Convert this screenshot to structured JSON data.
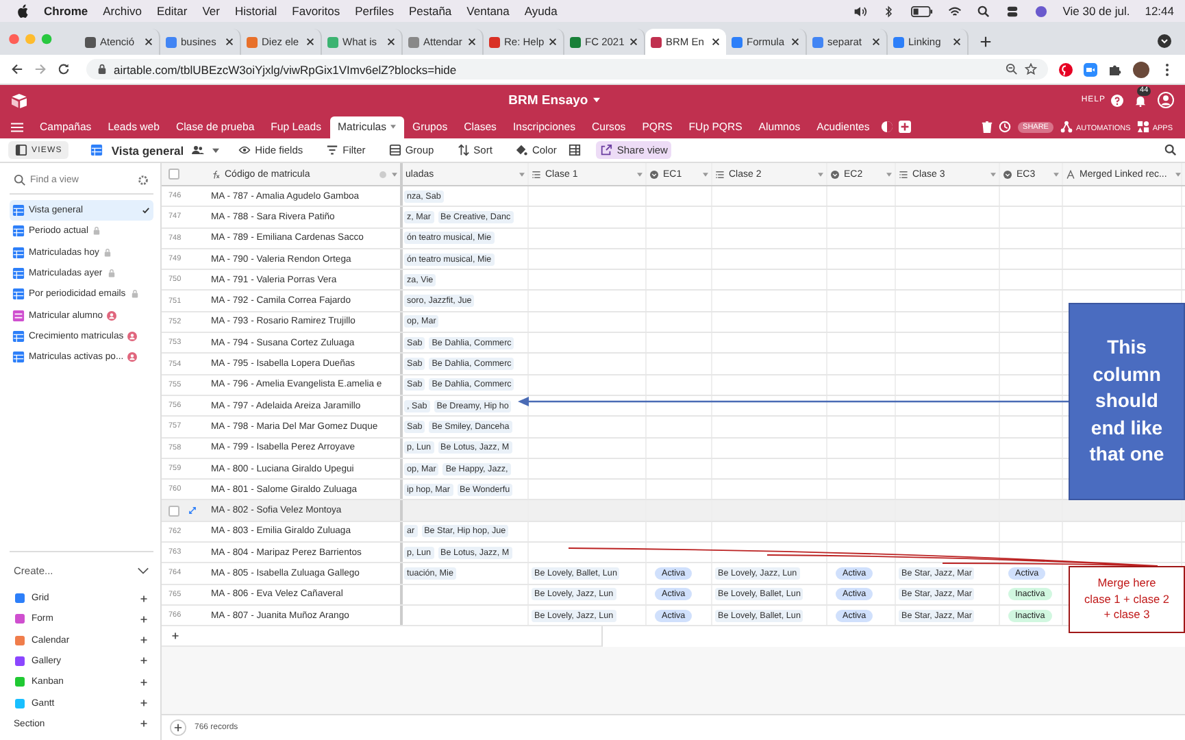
{
  "menubar": {
    "app": "Chrome",
    "items": [
      "Archivo",
      "Editar",
      "Ver",
      "Historial",
      "Favoritos",
      "Perfiles",
      "Pestaña",
      "Ventana",
      "Ayuda"
    ],
    "date": "Vie 30 de jul.",
    "time": "12:44"
  },
  "browser": {
    "tabs": [
      {
        "title": "Atenció",
        "selected": false,
        "color": "#555555"
      },
      {
        "title": "busines",
        "selected": false,
        "color": "#4285f4"
      },
      {
        "title": "Diez ele",
        "selected": false,
        "color": "#e8702a"
      },
      {
        "title": "What is",
        "selected": false,
        "color": "#3cb371"
      },
      {
        "title": "Attendar",
        "selected": false,
        "color": "#888888"
      },
      {
        "title": "Re: Help",
        "selected": false,
        "color": "#d93025"
      },
      {
        "title": "FC 2021",
        "selected": false,
        "color": "#188038"
      },
      {
        "title": "BRM En",
        "selected": true,
        "color": "#c0304f"
      },
      {
        "title": "Formula",
        "selected": false,
        "color": "#2d7ff9"
      },
      {
        "title": "separat",
        "selected": false,
        "color": "#4285f4"
      },
      {
        "title": "Linking",
        "selected": false,
        "color": "#2d7ff9"
      }
    ],
    "url": "airtable.com/tblUBEzcW3oiYjxlg/viwRpGix1VImv6elZ?blocks=hide"
  },
  "app": {
    "title": "BRM Ensayo",
    "help": "HELP",
    "notifications": "44",
    "share": "SHARE",
    "automations": "AUTOMATIONS",
    "apps": "APPS",
    "tables": [
      {
        "label": "Campañas",
        "selected": false
      },
      {
        "label": "Leads web",
        "selected": false
      },
      {
        "label": "Clase de prueba",
        "selected": false
      },
      {
        "label": "Fup Leads",
        "selected": false
      },
      {
        "label": "Matriculas",
        "selected": true
      },
      {
        "label": "Grupos",
        "selected": false
      },
      {
        "label": "Clases",
        "selected": false
      },
      {
        "label": "Inscripciones",
        "selected": false
      },
      {
        "label": "Cursos",
        "selected": false
      },
      {
        "label": "PQRS",
        "selected": false
      },
      {
        "label": "FUp PQRS",
        "selected": false
      },
      {
        "label": "Alumnos",
        "selected": false
      },
      {
        "label": "Acudientes",
        "selected": false
      }
    ]
  },
  "toolbar": {
    "views": "VIEWS",
    "view_name": "Vista general",
    "hide_fields": "Hide fields",
    "filter": "Filter",
    "group": "Group",
    "sort": "Sort",
    "color_button": "Color",
    "share_view": "Share view"
  },
  "sidebar": {
    "search": {
      "placeholder": "Find a view"
    },
    "views": [
      {
        "name": "Vista general",
        "kind": "grid",
        "selected": true,
        "locked": false,
        "personal": false
      },
      {
        "name": "Periodo actual",
        "kind": "grid",
        "selected": false,
        "locked": true,
        "personal": false
      },
      {
        "name": "Matriculadas hoy",
        "kind": "grid",
        "selected": false,
        "locked": true,
        "personal": false
      },
      {
        "name": "Matriculadas ayer",
        "kind": "grid",
        "selected": false,
        "locked": true,
        "personal": false
      },
      {
        "name": "Por periodicidad emails",
        "kind": "grid",
        "selected": false,
        "locked": true,
        "personal": false
      },
      {
        "name": "Matricular alumno",
        "kind": "form",
        "selected": false,
        "locked": false,
        "personal": true
      },
      {
        "name": "Crecimiento matriculas",
        "kind": "grid",
        "selected": false,
        "locked": false,
        "personal": true
      },
      {
        "name": "Matriculas activas po...",
        "kind": "grid",
        "selected": false,
        "locked": false,
        "personal": true
      }
    ],
    "create": "Create...",
    "types": [
      {
        "name": "Grid",
        "color": "#2d7ff9"
      },
      {
        "name": "Form",
        "color": "#cf4fcf"
      },
      {
        "name": "Calendar",
        "color": "#f07d4b"
      },
      {
        "name": "Gallery",
        "color": "#8b46ff"
      },
      {
        "name": "Kanban",
        "color": "#20c933"
      },
      {
        "name": "Gantt",
        "color": "#18bfff"
      }
    ],
    "section": "Section"
  },
  "grid": {
    "all_selected": false,
    "columns": [
      {
        "label": "Código de matricula",
        "kind": "formula"
      },
      {
        "label": "uladas",
        "kind": "partial"
      },
      {
        "label": "Clase 1",
        "kind": "lines"
      },
      {
        "label": "EC1",
        "kind": "select"
      },
      {
        "label": "Clase 2",
        "kind": "lines"
      },
      {
        "label": "EC2",
        "kind": "select"
      },
      {
        "label": "Clase 3",
        "kind": "lines"
      },
      {
        "label": "EC3",
        "kind": "select"
      },
      {
        "label": "Merged Linked rec...",
        "kind": "text"
      }
    ],
    "rows": [
      {
        "number": "746",
        "code": "MA - 787 - Amalia Agudelo Gamboa",
        "hovered": false,
        "column_2": [
          "nza, Sab"
        ]
      },
      {
        "number": "747",
        "code": "MA - 788 - Sara Rivera Patiño",
        "hovered": false,
        "column_2": [
          "z, Mar",
          "Be Creative, Danc"
        ]
      },
      {
        "number": "748",
        "code": "MA - 789 - Emiliana Cardenas Sacco",
        "hovered": false,
        "column_2": [
          "ón teatro musical, Mie"
        ]
      },
      {
        "number": "749",
        "code": "MA - 790 - Valeria Rendon Ortega",
        "hovered": false,
        "column_2": [
          "ón teatro musical, Mie"
        ]
      },
      {
        "number": "750",
        "code": "MA - 791 - Valeria Porras Vera",
        "hovered": false,
        "column_2": [
          "za, Vie"
        ]
      },
      {
        "number": "751",
        "code": "MA - 792 - Camila Correa Fajardo",
        "hovered": false,
        "column_2": [
          "soro, Jazzfit, Jue"
        ]
      },
      {
        "number": "752",
        "code": "MA - 793 - Rosario Ramirez Trujillo",
        "hovered": false,
        "column_2": [
          "op, Mar"
        ]
      },
      {
        "number": "753",
        "code": "MA - 794 - Susana Cortez Zuluaga",
        "hovered": false,
        "column_2": [
          "Sab",
          "Be Dahlia, Commerc"
        ]
      },
      {
        "number": "754",
        "code": "MA - 795 - Isabella Lopera Dueñas",
        "hovered": false,
        "column_2": [
          "Sab",
          "Be Dahlia, Commerc"
        ]
      },
      {
        "number": "755",
        "code": "MA - 796 - Amelia Evangelista E.amelia e",
        "hovered": false,
        "column_2": [
          "Sab",
          "Be Dahlia, Commerc"
        ]
      },
      {
        "number": "756",
        "code": "MA - 797 - Adelaida Areiza Jaramillo",
        "hovered": false,
        "column_2": [
          ", Sab",
          "Be Dreamy, Hip ho"
        ]
      },
      {
        "number": "757",
        "code": "MA - 798 - Maria Del Mar Gomez Duque",
        "hovered": false,
        "column_2": [
          "Sab",
          "Be Smiley, Danceha"
        ]
      },
      {
        "number": "758",
        "code": "MA - 799 - Isabella Perez Arroyave",
        "hovered": false,
        "column_2": [
          "p, Lun",
          "Be Lotus, Jazz, M"
        ]
      },
      {
        "number": "759",
        "code": "MA - 800 - Luciana Giraldo Upegui",
        "hovered": false,
        "column_2": [
          "op, Mar",
          "Be Happy, Jazz,"
        ]
      },
      {
        "number": "760",
        "code": "MA - 801 - Salome Giraldo Zuluaga",
        "hovered": false,
        "column_2": [
          "ip hop, Mar",
          "Be Wonderfu"
        ]
      },
      {
        "code": "MA - 802 - Sofia Velez Montoya",
        "hovered": true,
        "checked": false,
        "column_2": []
      },
      {
        "number": "762",
        "code": "MA - 803 - Emilia Giraldo Zuluaga",
        "hovered": false,
        "column_2": [
          "ar",
          "Be Star, Hip hop, Jue"
        ]
      },
      {
        "number": "763",
        "code": "MA - 804 - Maripaz Perez Barrientos",
        "hovered": false,
        "column_2": [
          "p, Lun",
          "Be Lotus, Jazz, M"
        ]
      },
      {
        "number": "764",
        "code": "MA - 805 - Isabella Zuluaga Gallego",
        "hovered": false,
        "column_2": [
          "tuación, Mie"
        ],
        "clase_1": "Be Lovely, Ballet, Lun",
        "ec1": {
          "label": "Activa",
          "color": "#d0e0fc"
        },
        "clase_2": "Be Lovely, Jazz, Lun",
        "ec2": {
          "label": "Activa",
          "color": "#d0e0fc"
        },
        "clase_3": "Be Star, Jazz, Mar",
        "ec3": {
          "label": "Activa",
          "color": "#d0e0fc"
        }
      },
      {
        "number": "765",
        "code": "MA - 806 - Eva Velez Cañaveral",
        "hovered": false,
        "column_2": [],
        "clase_1": "Be Lovely, Jazz, Lun",
        "ec1": {
          "label": "Activa",
          "color": "#d0e0fc"
        },
        "clase_2": "Be Lovely, Ballet, Lun",
        "ec2": {
          "label": "Activa",
          "color": "#d0e0fc"
        },
        "clase_3": "Be Star, Jazz, Mar",
        "ec3": {
          "label": "Inactiva",
          "color": "#d1f7e0"
        }
      },
      {
        "number": "766",
        "code": "MA - 807 - Juanita Muñoz Arango",
        "hovered": false,
        "column_2": [],
        "clase_1": "Be Lovely, Jazz, Lun",
        "ec1": {
          "label": "Activa",
          "color": "#d0e0fc"
        },
        "clase_2": "Be Lovely, Ballet, Lun",
        "ec2": {
          "label": "Activa",
          "color": "#d0e0fc"
        },
        "clase_3": "Be Star, Jazz, Mar",
        "ec3": {
          "label": "Inactiva",
          "color": "#d1f7e0"
        }
      }
    ],
    "record_count": "766 records"
  },
  "annotations": [
    {
      "kind": "callout",
      "lines": [
        "This",
        "column",
        "should",
        "end like",
        "that one"
      ]
    },
    {
      "kind": "note",
      "lines": [
        "Merge here",
        "clase 1 + clase 2",
        "+ clase 3"
      ]
    }
  ]
}
